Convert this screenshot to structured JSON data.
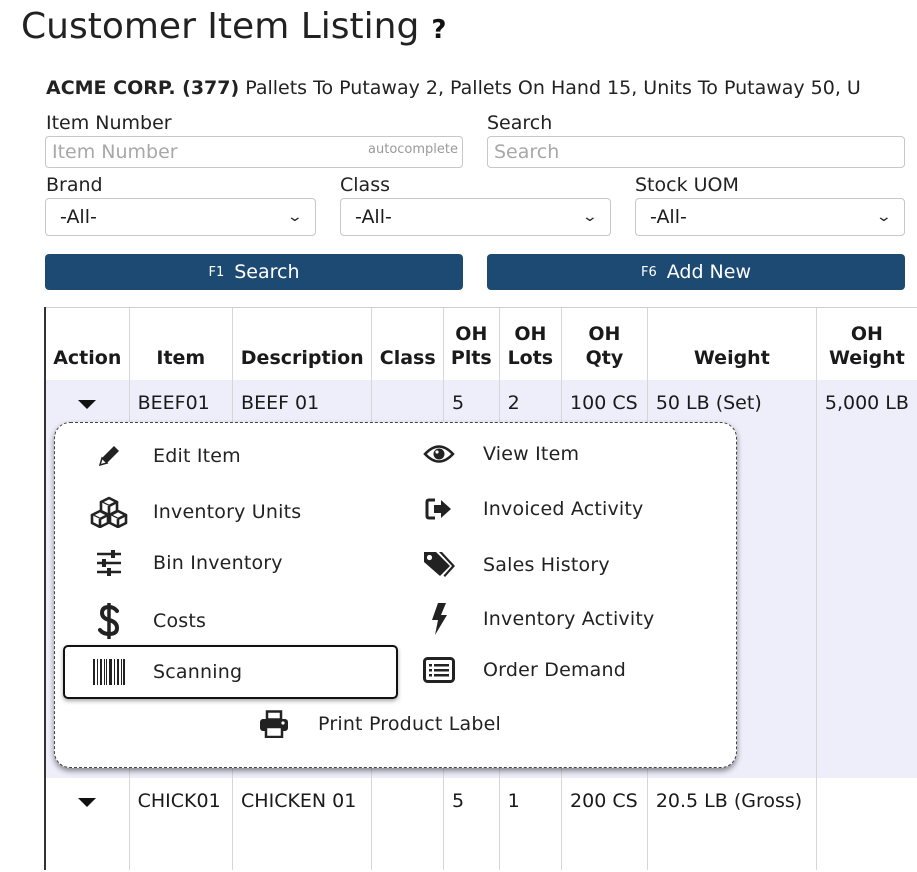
{
  "page": {
    "title": "Customer Item Listing",
    "help_symbol": "?"
  },
  "summary": {
    "customer": "ACME CORP. (377)",
    "stats": "Pallets To Putaway 2,  Pallets On Hand 15,  Units To Putaway 50,  U"
  },
  "filters": {
    "item_number_label": "Item Number",
    "item_number_placeholder": "Item Number",
    "item_number_hint": "autocomplete",
    "search_label": "Search",
    "search_placeholder": "Search",
    "brand_label": "Brand",
    "brand_value": "-All-",
    "class_label": "Class",
    "class_value": "-All-",
    "uom_label": "Stock UOM",
    "uom_value": "-All-"
  },
  "buttons": {
    "search_key": "F1",
    "search_label": "Search",
    "add_key": "F6",
    "add_label": "Add New"
  },
  "table": {
    "headers": {
      "action": "Action",
      "item": "Item",
      "description": "Description",
      "class": "Class",
      "oh_plts_1": "OH",
      "oh_plts_2": "Plts",
      "oh_lots_1": "OH",
      "oh_lots_2": "Lots",
      "oh_qty_1": "OH",
      "oh_qty_2": "Qty",
      "weight": "Weight",
      "oh_weight_1": "OH",
      "oh_weight_2": "Weight"
    },
    "rows": [
      {
        "item": "BEEF01",
        "description": "BEEF 01",
        "class": "",
        "oh_plts": "5",
        "oh_lots": "2",
        "oh_qty": "100 CS",
        "weight": "50 LB (Set)",
        "oh_weight": "5,000 LB"
      },
      {
        "item": "CHICK01",
        "description": "CHICKEN 01",
        "class": "",
        "oh_plts": "5",
        "oh_lots": "1",
        "oh_qty": "200 CS",
        "weight": "20.5 LB (Gross)",
        "oh_weight": ""
      }
    ]
  },
  "action_menu": {
    "edit_item": "Edit Item",
    "view_item": "View Item",
    "inventory_units": "Inventory Units",
    "invoiced_activity": "Invoiced Activity",
    "bin_inventory": "Bin Inventory",
    "sales_history": "Sales History",
    "costs": "Costs",
    "inventory_activity": "Inventory Activity",
    "scanning": "Scanning",
    "order_demand": "Order Demand",
    "print_product_label": "Print Product Label",
    "selected_item": "Scanning"
  }
}
